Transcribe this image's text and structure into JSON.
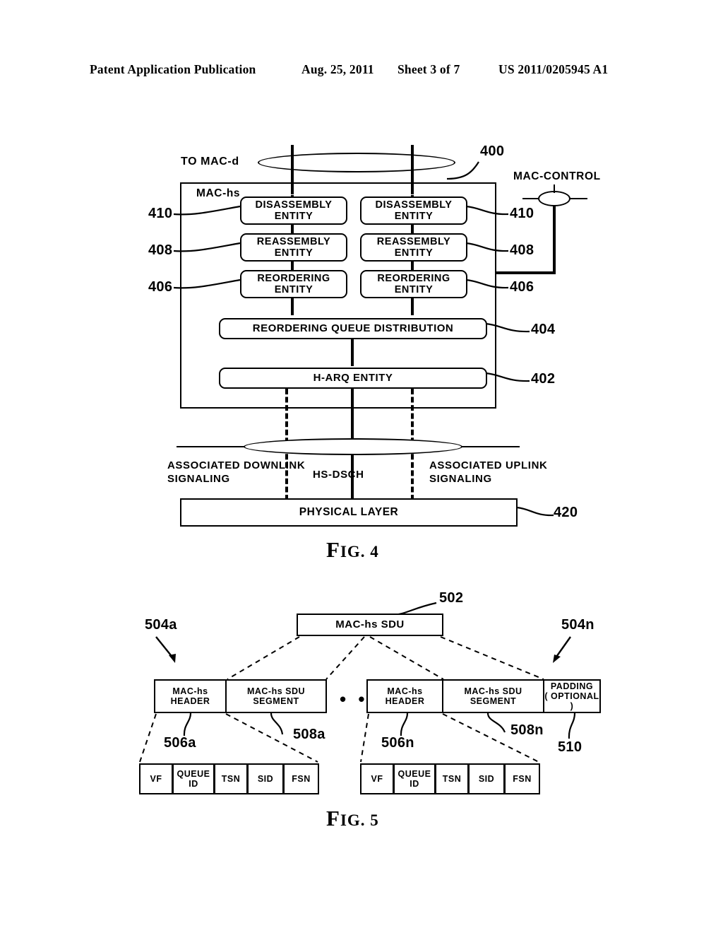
{
  "header": {
    "publication": "Patent Application Publication",
    "date": "Aug. 25, 2011",
    "sheet": "Sheet 3 of 7",
    "number": "US 2011/0205945 A1"
  },
  "figure4": {
    "caption": "FIG. 4",
    "caption_main": "F",
    "caption_rest": "IG. 4",
    "to_mac_d_label": "TO MAC-d",
    "mac_control_label": "MAC-CONTROL",
    "mac_hs_label": "MAC-hs",
    "ref_400": "400",
    "ref_420": "420",
    "entities": [
      {
        "label": "DISASSEMBLY\nENTITY",
        "line1": "DISASSEMBLY",
        "line2": "ENTITY",
        "ref": "410"
      },
      {
        "label": "REASSEMBLY\nENTITY",
        "line1": "REASSEMBLY",
        "line2": "ENTITY",
        "ref": "408"
      },
      {
        "label": "REORDERING\nENTITY",
        "line1": "REORDERING",
        "line2": "ENTITY",
        "ref": "406"
      }
    ],
    "wide_blocks": [
      {
        "label": "REORDERING QUEUE DISTRIBUTION",
        "ref": "404"
      },
      {
        "label": "H-ARQ ENTITY",
        "ref": "402"
      }
    ],
    "signaling": {
      "downlink_line1": "ASSOCIATED DOWNLINK",
      "downlink_line2": "SIGNALING",
      "channel": "HS-DSCH",
      "uplink_line1": "ASSOCIATED UPLINK",
      "uplink_line2": "SIGNALING"
    },
    "physical_layer": "PHYSICAL LAYER"
  },
  "figure5": {
    "caption_main": "F",
    "caption_rest": "IG. 5",
    "sdu_label": "MAC-hs SDU",
    "ref_502": "502",
    "ref_504a": "504a",
    "ref_504n": "504n",
    "ref_506a": "506a",
    "ref_508a": "508a",
    "ref_506n": "506n",
    "ref_508n": "508n",
    "ref_510": "510",
    "ellipsis": "• • •",
    "pdu_left": {
      "header_label": "MAC-hs HEADER",
      "segment_label": "MAC-hs SDU SEGMENT"
    },
    "pdu_right": {
      "header_label": "MAC-hs HEADER",
      "segment_label": "MAC-hs SDU SEGMENT",
      "padding_line1": "PADDING",
      "padding_line2": "( OPTIONAL )"
    },
    "header_fields_left": [
      {
        "line1": "VF",
        "line2": ""
      },
      {
        "line1": "QUEUE",
        "line2": "ID"
      },
      {
        "line1": "TSN",
        "line2": ""
      },
      {
        "line1": "SID",
        "line2": ""
      },
      {
        "line1": "FSN",
        "line2": ""
      }
    ],
    "header_fields_right": [
      {
        "line1": "VF",
        "line2": ""
      },
      {
        "line1": "QUEUE",
        "line2": "ID"
      },
      {
        "line1": "TSN",
        "line2": ""
      },
      {
        "line1": "SID",
        "line2": ""
      },
      {
        "line1": "FSN",
        "line2": ""
      }
    ]
  },
  "colors": {
    "ink": "#000000",
    "paper": "#ffffff"
  }
}
